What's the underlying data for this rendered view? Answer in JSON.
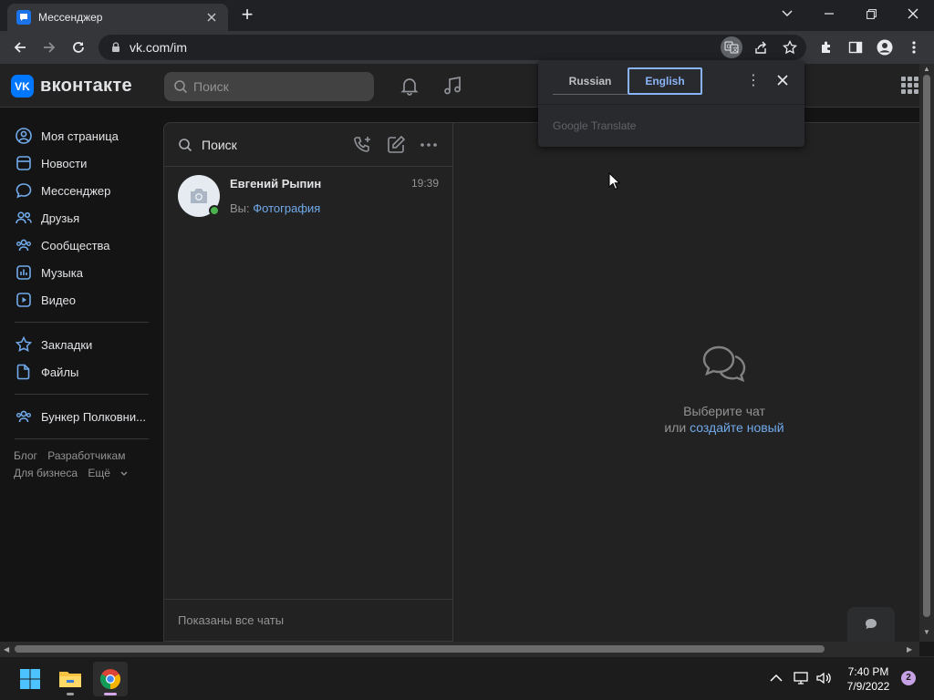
{
  "browser": {
    "tab_title": "Мессенджер",
    "url": "vk.com/im"
  },
  "vk": {
    "logo_text": "вконтакте",
    "search_placeholder": "Поиск",
    "nav": [
      {
        "label": "Моя страница",
        "icon": "user-circle-icon"
      },
      {
        "label": "Новости",
        "icon": "newsfeed-icon"
      },
      {
        "label": "Мессенджер",
        "icon": "message-icon"
      },
      {
        "label": "Друзья",
        "icon": "friends-icon"
      },
      {
        "label": "Сообщества",
        "icon": "communities-icon"
      },
      {
        "label": "Музыка",
        "icon": "music-icon"
      },
      {
        "label": "Видео",
        "icon": "video-icon"
      },
      {
        "label": "Закладки",
        "icon": "bookmark-star-icon"
      },
      {
        "label": "Файлы",
        "icon": "file-icon"
      },
      {
        "label": "Бункер Полковни...",
        "icon": "community-group-icon"
      }
    ],
    "footer_links": [
      "Блог",
      "Разработчикам",
      "Для бизнеса",
      "Ещё"
    ]
  },
  "chatlist": {
    "search_placeholder": "Поиск",
    "chats": [
      {
        "name": "Евгений Рыпин",
        "time": "19:39",
        "preview_prefix": "Вы:",
        "preview_attachment": "Фотография",
        "online": true
      }
    ],
    "footer": "Показаны все чаты"
  },
  "empty_chat": {
    "line1": "Выберите чат",
    "line2_prefix": "или",
    "line2_link": "создайте новый"
  },
  "translate_popup": {
    "tabs": [
      "Russian",
      "English"
    ],
    "active_tab": "English",
    "brand": "Google Translate"
  },
  "taskbar": {
    "time": "7:40 PM",
    "date": "7/9/2022",
    "notification_count": "2"
  },
  "colors": {
    "vk_blue": "#0077ff",
    "link": "#71aaeb",
    "online": "#4bb34b",
    "translate_active": "#8ab4f8"
  }
}
